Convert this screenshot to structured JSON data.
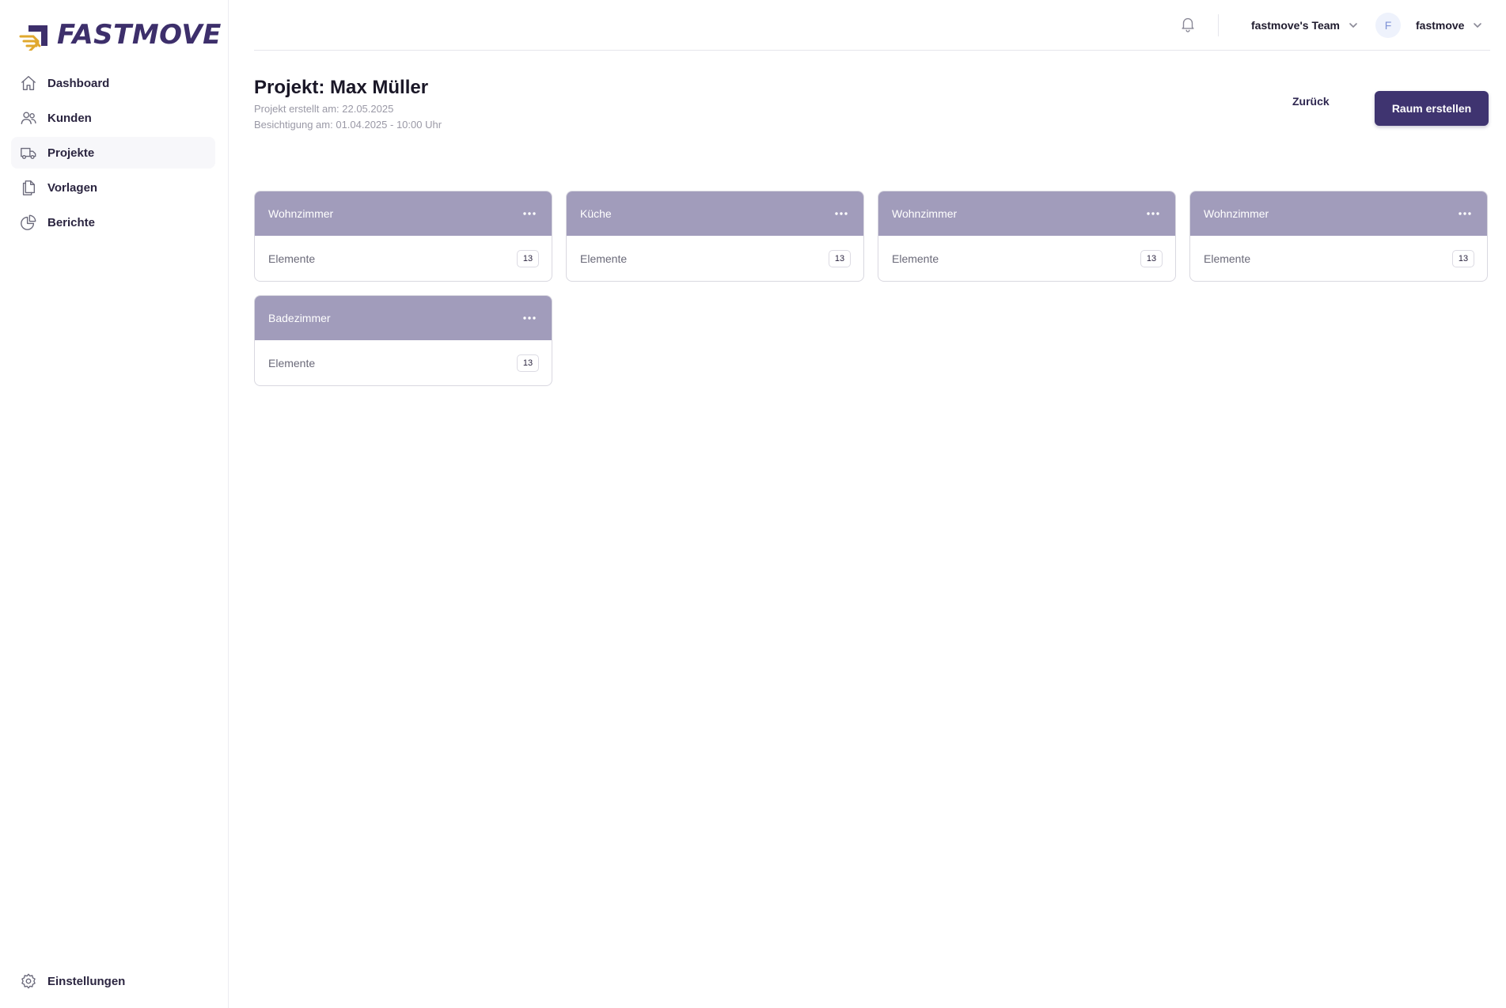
{
  "brand": {
    "name": "FASTMOVE",
    "primary_color": "#3f3470",
    "accent_color": "#e0a82e",
    "card_header_color": "#a19cbb"
  },
  "sidebar": {
    "items": [
      {
        "label": "Dashboard",
        "icon": "home-icon",
        "active": false
      },
      {
        "label": "Kunden",
        "icon": "users-icon",
        "active": false
      },
      {
        "label": "Projekte",
        "icon": "truck-icon",
        "active": true
      },
      {
        "label": "Vorlagen",
        "icon": "documents-icon",
        "active": false
      },
      {
        "label": "Berichte",
        "icon": "pie-chart-icon",
        "active": false
      }
    ],
    "settings_label": "Einstellungen"
  },
  "topbar": {
    "team_label": "fastmove's Team",
    "avatar_initial": "F",
    "user_label": "fastmove"
  },
  "header": {
    "title": "Projekt: Max Müller",
    "created": "Projekt erstellt am: 22.05.2025",
    "viewing": "Besichtigung am: 01.04.2025 - 10:00 Uhr",
    "back_label": "Zurück",
    "create_label": "Raum erstellen"
  },
  "rooms": [
    {
      "name": "Wohnzimmer",
      "elements_label": "Elemente",
      "count": "13"
    },
    {
      "name": "Küche",
      "elements_label": "Elemente",
      "count": "13"
    },
    {
      "name": "Wohnzimmer",
      "elements_label": "Elemente",
      "count": "13"
    },
    {
      "name": "Wohnzimmer",
      "elements_label": "Elemente",
      "count": "13"
    },
    {
      "name": "Badezimmer",
      "elements_label": "Elemente",
      "count": "13"
    }
  ]
}
